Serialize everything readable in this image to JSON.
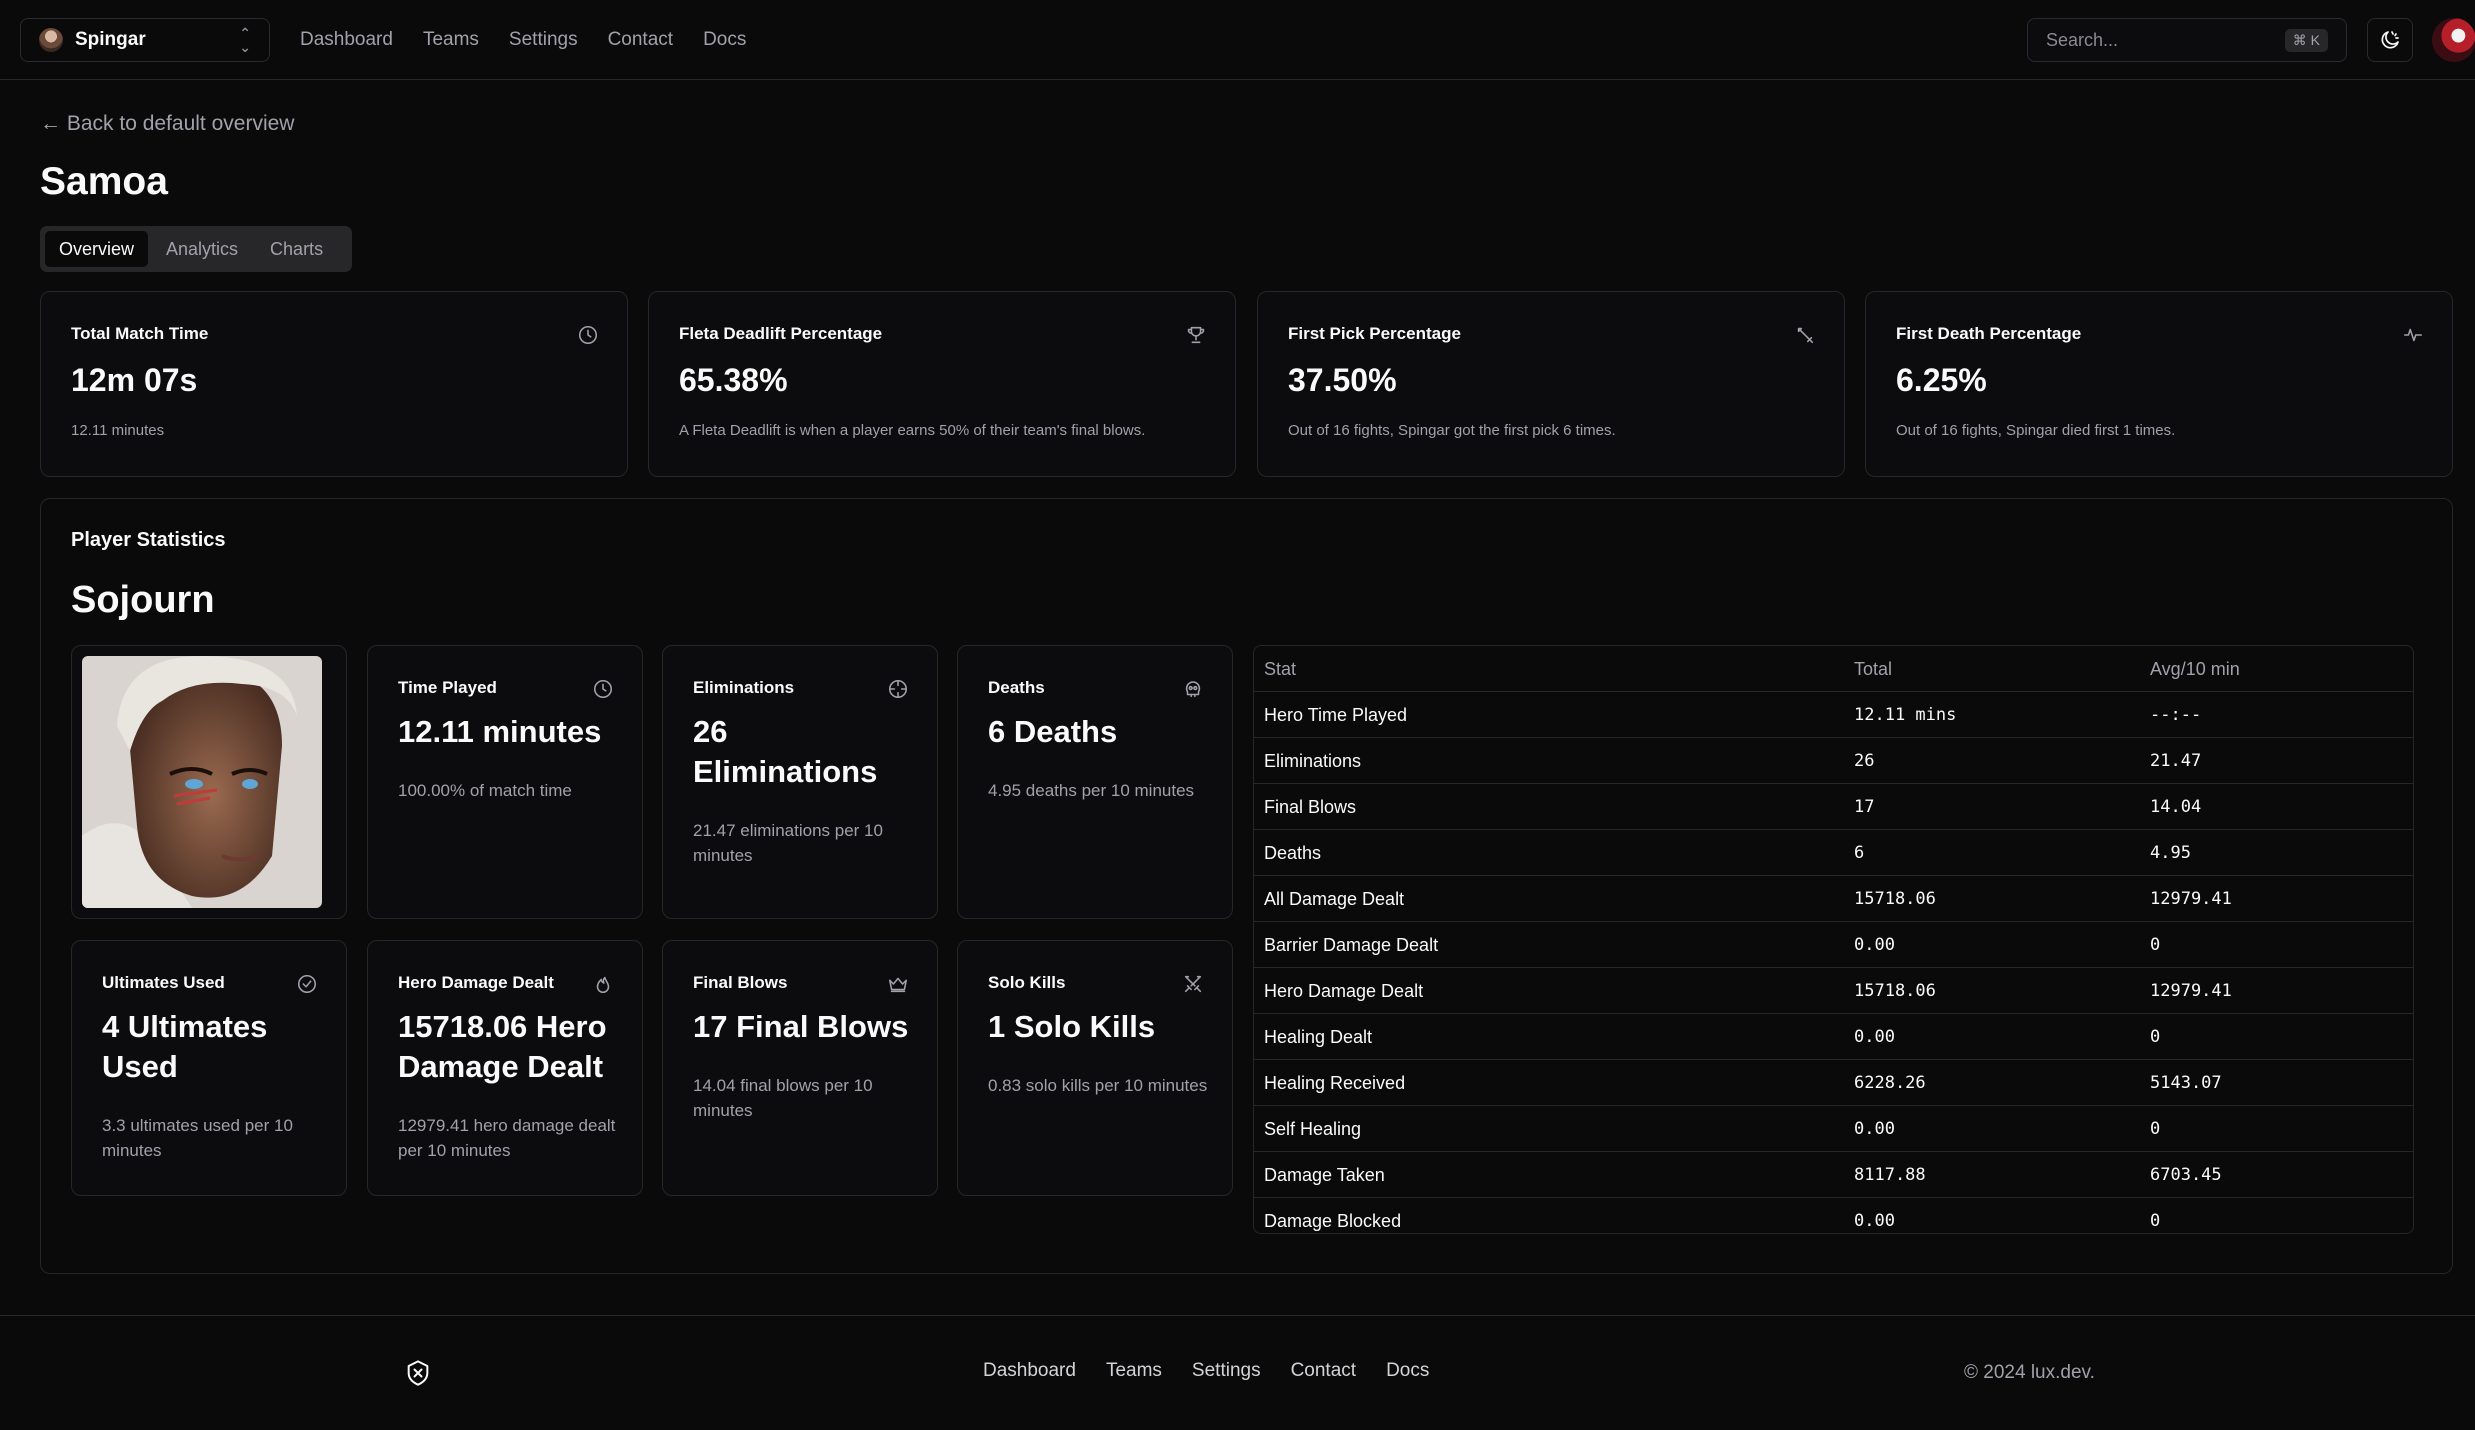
{
  "topbar": {
    "team_name": "Spingar",
    "nav": [
      "Dashboard",
      "Teams",
      "Settings",
      "Contact",
      "Docs"
    ],
    "search_placeholder": "Search...",
    "search_shortcut": "⌘ K"
  },
  "back_link": "← Back to default overview",
  "page_title": "Samoa",
  "tabs": [
    {
      "label": "Overview",
      "active": true
    },
    {
      "label": "Analytics",
      "active": false
    },
    {
      "label": "Charts",
      "active": false
    }
  ],
  "summary_cards": [
    {
      "label": "Total Match Time",
      "value": "12m 07s",
      "desc": "12.11 minutes",
      "icon": "clock-icon"
    },
    {
      "label": "Fleta Deadlift Percentage",
      "value": "65.38%",
      "desc": "A Fleta Deadlift is when a player earns 50% of their team's final blows.",
      "icon": "trophy-icon"
    },
    {
      "label": "First Pick Percentage",
      "value": "37.50%",
      "desc": "Out of 16 fights, Spingar got the first pick 6 times.",
      "icon": "sword-icon"
    },
    {
      "label": "First Death Percentage",
      "value": "6.25%",
      "desc": "Out of 16 fights, Spingar died first 1 times.",
      "icon": "activity-icon"
    }
  ],
  "player_stats": {
    "title": "Player Statistics",
    "hero": "Sojourn",
    "cards": [
      {
        "label": "Time Played",
        "value": "12.11 minutes",
        "desc": "100.00% of match time",
        "icon": "clock-icon"
      },
      {
        "label": "Eliminations",
        "value": "26 Eliminations",
        "desc": "21.47 eliminations per 10 minutes",
        "icon": "crosshair-icon"
      },
      {
        "label": "Deaths",
        "value": "6 Deaths",
        "desc": "4.95 deaths per 10 minutes",
        "icon": "skull-icon"
      },
      {
        "label": "Ultimates Used",
        "value": "4 Ultimates Used",
        "desc": "3.3 ultimates used per 10 minutes",
        "icon": "check-circle-icon"
      },
      {
        "label": "Hero Damage Dealt",
        "value": "15718.06 Hero Damage Dealt",
        "desc": "12979.41 hero damage dealt per 10 minutes",
        "icon": "flame-icon"
      },
      {
        "label": "Final Blows",
        "value": "17 Final Blows",
        "desc": "14.04 final blows per 10 minutes",
        "icon": "crown-icon"
      },
      {
        "label": "Solo Kills",
        "value": "1 Solo Kills",
        "desc": "0.83 solo kills per 10 minutes",
        "icon": "swords-icon"
      }
    ],
    "table": {
      "headers": [
        "Stat",
        "Total",
        "Avg/10 min"
      ],
      "rows": [
        [
          "Hero Time Played",
          "12.11 mins",
          "--:--"
        ],
        [
          "Eliminations",
          "26",
          "21.47"
        ],
        [
          "Final Blows",
          "17",
          "14.04"
        ],
        [
          "Deaths",
          "6",
          "4.95"
        ],
        [
          "All Damage Dealt",
          "15718.06",
          "12979.41"
        ],
        [
          "Barrier Damage Dealt",
          "0.00",
          "0"
        ],
        [
          "Hero Damage Dealt",
          "15718.06",
          "12979.41"
        ],
        [
          "Healing Dealt",
          "0.00",
          "0"
        ],
        [
          "Healing Received",
          "6228.26",
          "5143.07"
        ],
        [
          "Self Healing",
          "0.00",
          "0"
        ],
        [
          "Damage Taken",
          "8117.88",
          "6703.45"
        ],
        [
          "Damage Blocked",
          "0.00",
          "0"
        ]
      ]
    }
  },
  "footer": {
    "nav": [
      "Dashboard",
      "Teams",
      "Settings",
      "Contact",
      "Docs"
    ],
    "copyright": "© 2024 lux.dev."
  }
}
